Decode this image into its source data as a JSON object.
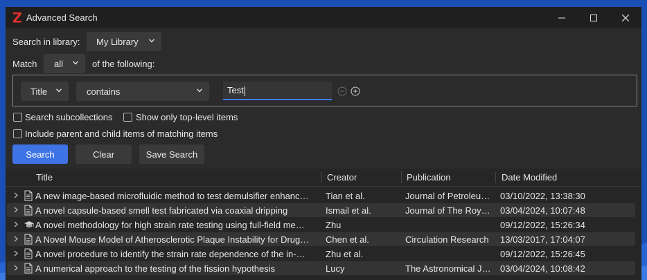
{
  "window": {
    "title": "Advanced Search",
    "controls": [
      "minimize-icon",
      "maximize-icon",
      "close-icon"
    ]
  },
  "search_in": {
    "label": "Search in library:",
    "library": "My Library"
  },
  "match": {
    "label": "Match",
    "mode": "all",
    "suffix": "of the following:"
  },
  "condition": {
    "field": "Title",
    "operator": "contains",
    "value": "Test"
  },
  "options": {
    "subcollections": "Search subcollections",
    "top_level": "Show only top-level items",
    "parent_child": "Include parent and child items of matching items"
  },
  "buttons": {
    "search": "Search",
    "clear": "Clear",
    "save": "Save Search"
  },
  "results": {
    "columns": [
      "Title",
      "Creator",
      "Publication",
      "Date Modified"
    ],
    "rows": [
      {
        "icon": "document-icon",
        "title": "A new image-based microfluidic method to test demulsifier enhanc…",
        "creator": "Tian et al.",
        "publication": "Journal of Petroleu…",
        "date": "03/10/2022, 13:38:30"
      },
      {
        "icon": "document-icon",
        "title": "A novel capsule-based smell test fabricated via coaxial dripping",
        "creator": "Ismail et al.",
        "publication": "Journal of The Roy…",
        "date": "03/04/2024, 10:07:48"
      },
      {
        "icon": "thesis-icon",
        "title": "A novel methodology for high strain rate testing using full-field me…",
        "creator": "Zhu",
        "publication": "",
        "date": "09/12/2022, 15:26:34"
      },
      {
        "icon": "document-icon",
        "title": "A Novel Mouse Model of Atherosclerotic Plaque Instability for Drug…",
        "creator": "Chen et al.",
        "publication": "Circulation Research",
        "date": "13/03/2017, 17:04:07"
      },
      {
        "icon": "document-icon",
        "title": "A novel procedure to identify the strain rate dependence of the in-…",
        "creator": "Zhu et al.",
        "publication": "",
        "date": "09/12/2022, 15:26:45"
      },
      {
        "icon": "document-icon",
        "title": "A numerical approach to the testing of the fission hypothesis",
        "creator": "Lucy",
        "publication": "The Astronomical J…",
        "date": "03/04/2024, 10:08:42"
      }
    ]
  },
  "colors": {
    "accent": "#3e73e6",
    "window_bg": "#2b2b2b",
    "titlebar_bg": "#1f1f1f",
    "logo": "#e0322b",
    "desktop": "#1a4fb5"
  }
}
